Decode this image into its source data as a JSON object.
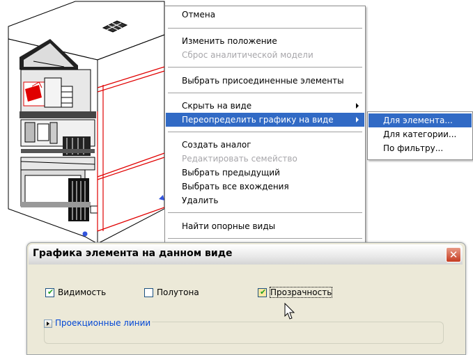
{
  "context_menu": {
    "items": [
      {
        "label": "Отмена",
        "enabled": true
      },
      {
        "label": "Изменить положение",
        "enabled": true
      },
      {
        "label": "Сброс аналитической модели",
        "enabled": false
      },
      {
        "label": "Выбрать присоединенные элементы",
        "enabled": true
      },
      {
        "label": "Скрыть на виде",
        "enabled": true,
        "submenu": true
      },
      {
        "label": "Переопределить графику на виде",
        "enabled": true,
        "submenu": true,
        "highlighted": true
      },
      {
        "label": "Создать аналог",
        "enabled": true
      },
      {
        "label": "Редактировать семейство",
        "enabled": false
      },
      {
        "label": "Выбрать предыдущий",
        "enabled": true
      },
      {
        "label": "Выбрать все вхождения",
        "enabled": true
      },
      {
        "label": "Удалить",
        "enabled": true
      },
      {
        "label": "Найти опорные виды",
        "enabled": true
      }
    ]
  },
  "submenu": {
    "items": [
      {
        "label": "Для элемента...",
        "highlighted": true
      },
      {
        "label": "Для категории..."
      },
      {
        "label": "По фильтру..."
      }
    ]
  },
  "dialog": {
    "title": "Графика элемента на данном виде",
    "close_label": "✕",
    "checkboxes": [
      {
        "label": "Видимость",
        "checked": true
      },
      {
        "label": "Полутона",
        "checked": false
      },
      {
        "label": "Прозрачность",
        "checked": true
      }
    ],
    "section_label": "Проекционные линии"
  },
  "colors": {
    "highlight": "#316ac5",
    "model_accent": "#e00000",
    "dialog_bg": "#ece9d8",
    "link_blue": "#0046d5"
  }
}
